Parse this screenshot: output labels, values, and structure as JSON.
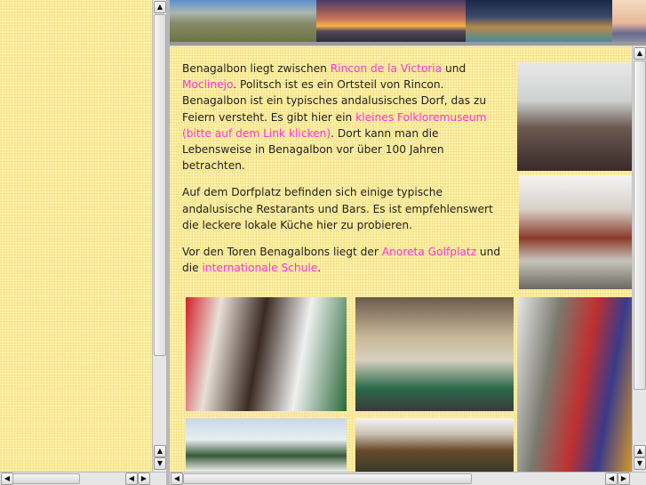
{
  "main": {
    "paragraphs": [
      {
        "t1": "Benagalbon liegt zwischen ",
        "l1": "Rincon de la Victoria",
        "t2": " und ",
        "l2": "Moclinejo",
        "t3": ". Politsch ist es ein Ortsteil von Rincon. Benagalbon ist ein typisches andalusisches Dorf, das zu Feiern versteht. Es gibt hier ein ",
        "l3": "kleines Folkloremuseum (bitte auf dem Link klicken)",
        "t4": ". Dort kann man die Lebensweise in Benagalbon vor über 100 Jahren betrachten."
      },
      {
        "t1": "Auf dem Dorfplatz befinden sich einige typische andalusische Restarants und Bars. Es ist empfehlenswert die leckere lokale Küche hier zu probieren."
      },
      {
        "t1": "Vor den Toren Benagalbons liegt der ",
        "l1": "Anoreta Golfplatz",
        "t2": " und die ",
        "l2": "internationale Schule",
        "t3": "."
      }
    ]
  },
  "colors": {
    "link": "#ff33dd",
    "background": "#fbeea0"
  }
}
